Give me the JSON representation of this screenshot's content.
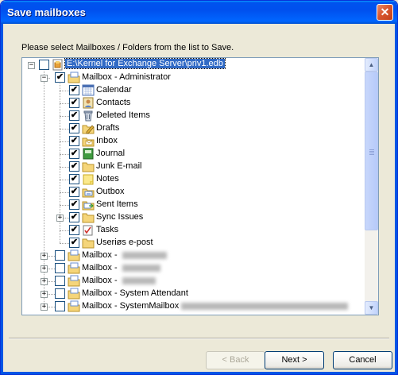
{
  "window": {
    "title": "Save mailboxes",
    "close_glyph": "✕"
  },
  "instruction": "Please select Mailboxes / Folders from the list to Save.",
  "tree": {
    "root": {
      "label": "E:\\Kernel for Exchange Server\\priv1.edb",
      "expander": "−",
      "checked": false
    },
    "mailbox_admin": {
      "label": "Mailbox - Administrator",
      "expander": "−",
      "checked": true
    },
    "folders": [
      {
        "label": "Calendar",
        "icon": "calendar-icon",
        "checked": true
      },
      {
        "label": "Contacts",
        "icon": "contacts-icon",
        "checked": true
      },
      {
        "label": "Deleted Items",
        "icon": "trash-icon",
        "checked": true
      },
      {
        "label": "Drafts",
        "icon": "drafts-icon",
        "checked": true
      },
      {
        "label": "Inbox",
        "icon": "inbox-icon",
        "checked": true
      },
      {
        "label": "Journal",
        "icon": "journal-icon",
        "checked": true
      },
      {
        "label": "Junk E-mail",
        "icon": "folder-icon",
        "checked": true
      },
      {
        "label": "Notes",
        "icon": "notes-icon",
        "checked": true
      },
      {
        "label": "Outbox",
        "icon": "outbox-icon",
        "checked": true
      },
      {
        "label": "Sent Items",
        "icon": "sent-items-icon",
        "checked": true
      },
      {
        "label": "Sync Issues",
        "icon": "folder-icon",
        "checked": true,
        "expander": "+"
      },
      {
        "label": "Tasks",
        "icon": "tasks-icon",
        "checked": true
      },
      {
        "label": "Useriøs e-post",
        "icon": "folder-icon",
        "checked": true
      }
    ],
    "other_mailboxes": [
      {
        "label": "Mailbox - ",
        "checked": false,
        "expander": "+"
      },
      {
        "label": "Mailbox - ",
        "checked": false,
        "expander": "+"
      },
      {
        "label": "Mailbox - ",
        "checked": false,
        "expander": "+"
      },
      {
        "label": "Mailbox - System Attendant",
        "checked": false,
        "expander": "+"
      },
      {
        "label": "Mailbox - SystemMailbox",
        "checked": false,
        "expander": "+"
      }
    ]
  },
  "buttons": {
    "back": "< Back",
    "next": "Next >",
    "cancel": "Cancel"
  },
  "check_glyph": "✔",
  "scroll_up_glyph": "▲",
  "scroll_down_glyph": "▼"
}
